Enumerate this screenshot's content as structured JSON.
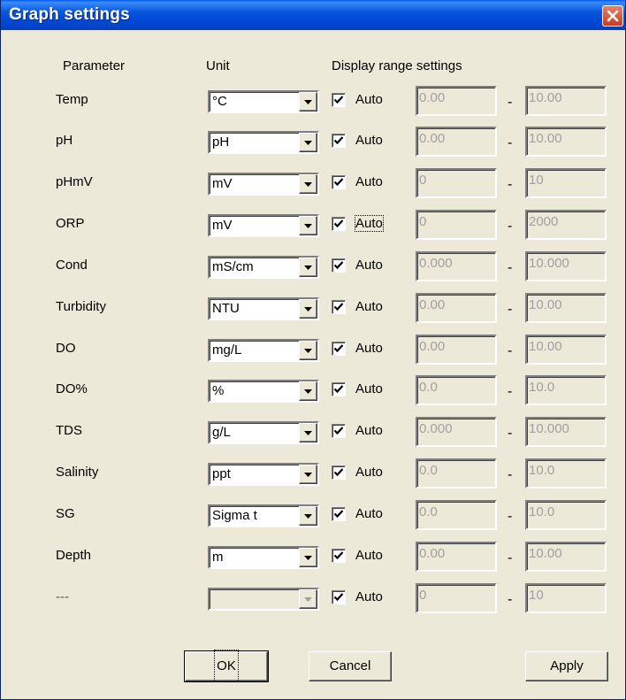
{
  "window": {
    "title": "Graph settings"
  },
  "headers": {
    "parameter": "Parameter",
    "unit": "Unit",
    "range": "Display range settings"
  },
  "rows": [
    {
      "param": "Temp",
      "unit": "°C",
      "auto": "Auto",
      "checked": true,
      "min": "0.00",
      "max": "10.00",
      "sep": "-"
    },
    {
      "param": "pH",
      "unit": "pH",
      "auto": "Auto",
      "checked": true,
      "min": "0.00",
      "max": "10.00",
      "sep": "-"
    },
    {
      "param": "pHmV",
      "unit": "mV",
      "auto": "Auto",
      "checked": true,
      "min": "0",
      "max": "10",
      "sep": "-"
    },
    {
      "param": "ORP",
      "unit": "mV",
      "auto": "Auto",
      "checked": true,
      "min": "0",
      "max": "2000",
      "sep": "-"
    },
    {
      "param": "Cond",
      "unit": "mS/cm",
      "auto": "Auto",
      "checked": true,
      "min": "0.000",
      "max": "10.000",
      "sep": "-"
    },
    {
      "param": "Turbidity",
      "unit": "NTU",
      "auto": "Auto",
      "checked": true,
      "min": "0.00",
      "max": "10.00",
      "sep": "-"
    },
    {
      "param": "DO",
      "unit": "mg/L",
      "auto": "Auto",
      "checked": true,
      "min": "0.00",
      "max": "10.00",
      "sep": "-"
    },
    {
      "param": "DO%",
      "unit": "%",
      "auto": "Auto",
      "checked": true,
      "min": "0.0",
      "max": "10.0",
      "sep": "-"
    },
    {
      "param": "TDS",
      "unit": "g/L",
      "auto": "Auto",
      "checked": true,
      "min": "0.000",
      "max": "10.000",
      "sep": "-"
    },
    {
      "param": "Salinity",
      "unit": "ppt",
      "auto": "Auto",
      "checked": true,
      "min": "0.0",
      "max": "10.0",
      "sep": "-"
    },
    {
      "param": "SG",
      "unit": "Sigma t",
      "auto": "Auto",
      "checked": true,
      "min": "0.0",
      "max": "10.0",
      "sep": "-"
    },
    {
      "param": "Depth",
      "unit": "m",
      "auto": "Auto",
      "checked": true,
      "min": "0.00",
      "max": "10.00",
      "sep": "-"
    },
    {
      "param": "---",
      "unit": "",
      "auto": "Auto",
      "checked": true,
      "min": "0",
      "max": "10",
      "sep": "-"
    }
  ],
  "buttons": {
    "ok": "OK",
    "cancel": "Cancel",
    "apply": "Apply"
  },
  "colors": {
    "title_bar": "#0855dd",
    "dialog_bg": "#ece9d8",
    "close_button": "#d4502e",
    "disabled_text": "#a0a0a0"
  },
  "icons": {
    "close": "close-icon",
    "dropdown": "chevron-down-icon",
    "check": "check-icon"
  }
}
